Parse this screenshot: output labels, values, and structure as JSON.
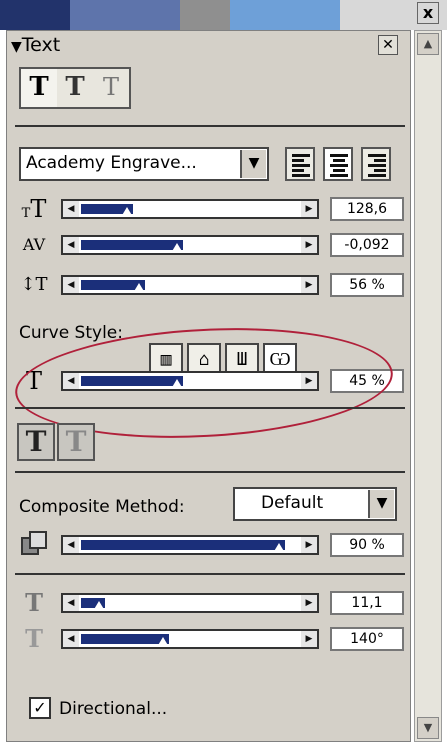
{
  "panel": {
    "title": "Text",
    "close_glyph": "✕"
  },
  "window_close": "x",
  "top_colors": [
    "#22336b",
    "#5e74ab",
    "#8f8f8f",
    "#6ea0d8",
    "#d8d8d8"
  ],
  "text_style_buttons": [
    "T",
    "T",
    "T"
  ],
  "font": {
    "name": "Academy Engrave..."
  },
  "alignment": [
    "align-left",
    "align-center",
    "align-right"
  ],
  "size": {
    "value": "128,6",
    "level": 0.25
  },
  "tracking": {
    "value": "-0,092",
    "level": 0.45
  },
  "leading": {
    "value": "56 %",
    "level": 0.3
  },
  "curve": {
    "label": "Curve Style:",
    "styles": [
      "flat",
      "arch",
      "bulge",
      "wave"
    ],
    "value": "45 %",
    "level": 0.45
  },
  "effect_buttons": [
    "T",
    "T"
  ],
  "composite": {
    "label": "Composite Method:",
    "value": "Default",
    "opacity": "90 %",
    "level": 0.9
  },
  "shadow_distance": {
    "value": "11,1",
    "level": 0.12
  },
  "shadow_angle": {
    "value": "140°",
    "level": 0.39
  },
  "directional": {
    "label": "Directional...",
    "checked": true
  },
  "accent_colors": {
    "slider_fill": "#1b2f7a",
    "annotation_circle": "#b0203a"
  }
}
